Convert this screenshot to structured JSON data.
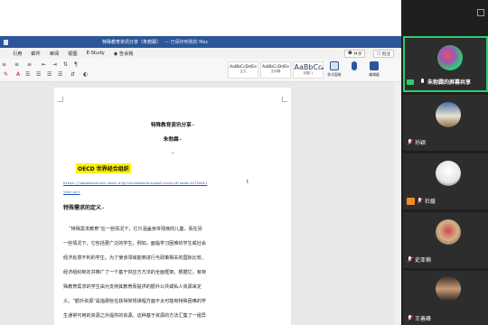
{
  "word": {
    "title": "特殊教育资讯分享（朱勃霖）",
    "save_status": "— 已保存到我的 Mac",
    "menu": [
      "引用",
      "邮件",
      "审阅",
      "视图",
      "E-Study",
      "告诉我"
    ],
    "share_label": "共享",
    "comment_label": "批注",
    "styles": [
      {
        "preview": "AaBbCcDdEe",
        "label": "正文"
      },
      {
        "preview": "AaBbCcDdEe",
        "label": "无间隔"
      },
      {
        "preview": "AaBbCc",
        "label": "标题 1"
      }
    ],
    "style_pane_label": "样式窗格",
    "editor_label": "编辑器"
  },
  "document": {
    "title": "特殊教育资讯分享",
    "author": "朱勃霖",
    "heading": "OECD 世界经合组织",
    "link_line1": "https://apaeducation.oecd.org/reviewducationpolicies/#!node=41752&fi",
    "link_line2": "lter=all",
    "subheading": "特殊需求的定义",
    "paragraph": [
      "“特殊需求教育”在一些情况下，它只涵盖身体残疾的儿童，而在另",
      "一些情况下，它包括更广泛的学生，例如，面临学习困难的学生或社会",
      "经济处境不利的学生。为了使该领域能够进行与政策相关的国际比较，",
      "经济组织制定并推广了一个基于供应方方法的全面框架。根据它，有特",
      "殊教育需求的学生由为支持其教育而提供的额外公共或私人资源来定",
      "义。“额外资源”是指那些在获得常规课程方面不太可能有特殊困难的学",
      "生通常可用的资源之外提供的资源。这种基于资源的方法汇集了一组异"
    ]
  },
  "participants": {
    "tiles": [
      {
        "name": "朱勃霖的屏幕共享",
        "active": true
      },
      {
        "name": "孙颖",
        "active": false
      },
      {
        "name": "杜媛",
        "active": false
      },
      {
        "name": "史亚楠",
        "active": false
      },
      {
        "name": "王善峰",
        "active": false
      }
    ]
  },
  "colors": {
    "word_blue": "#2b579a",
    "active_border": "#2ecc71",
    "highlight": "#fff200",
    "link": "#1a56b5"
  }
}
